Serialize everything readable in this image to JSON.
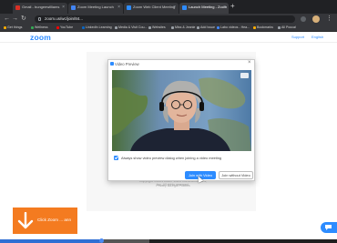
{
  "browser": {
    "tabs": [
      {
        "label": "Gmail - bungeewilliams",
        "active": false,
        "favicon_color": "#d93025"
      },
      {
        "label": "Zoom Meeting Launch",
        "active": false,
        "favicon_color": "#4285f4"
      },
      {
        "label": "Zoom Web Client Meeting",
        "active": false,
        "favicon_color": "#2d8cff"
      },
      {
        "label": "Launch Meeting - Zoom",
        "active": true,
        "favicon_color": "#2d8cff"
      }
    ],
    "new_tab": "+",
    "url": "zoom.us/wc/join/84..."
  },
  "bookmarks": [
    {
      "label": "Get things",
      "color": "#f9ab00"
    },
    {
      "label": "Wellness",
      "color": "#34a853"
    },
    {
      "label": "YouTube",
      "color": "#ff0000"
    },
    {
      "label": "LinkedIn Learning",
      "color": "#0a66c2"
    },
    {
      "label": "Media & Visit Cou...",
      "color": "#9aa0a6"
    },
    {
      "label": "Websites",
      "color": "#9aa0a6"
    },
    {
      "label": "Miss & Jeanie",
      "color": "#9aa0a6"
    },
    {
      "label": "Add Issue",
      "color": "#9aa0a6"
    },
    {
      "label": "Labo videos - Hea...",
      "color": "#4285f4"
    },
    {
      "label": "Bookmarks",
      "color": "#f9ab00"
    },
    {
      "label": "All Poccal",
      "color": "#9aa0a6"
    }
  ],
  "zoom": {
    "logo": "zoom",
    "support": "Support",
    "language": "English"
  },
  "dialog": {
    "title": "Video Preview",
    "checkbox_label": "Always show video preview dialog when joining a video meeting",
    "checkbox_checked": true,
    "join_with_video": "Join with Video",
    "join_without_video": "Join without Video"
  },
  "background_text": {
    "line1": "Copyright ©2021 Zoom Video Communications, Inc. All rights reserved.",
    "line2": "Privacy & Legal Policies"
  },
  "overlay": {
    "banner_text": "Click Zoom ... ann",
    "banner_color": "#f47b20"
  },
  "video_progress": 0.3
}
